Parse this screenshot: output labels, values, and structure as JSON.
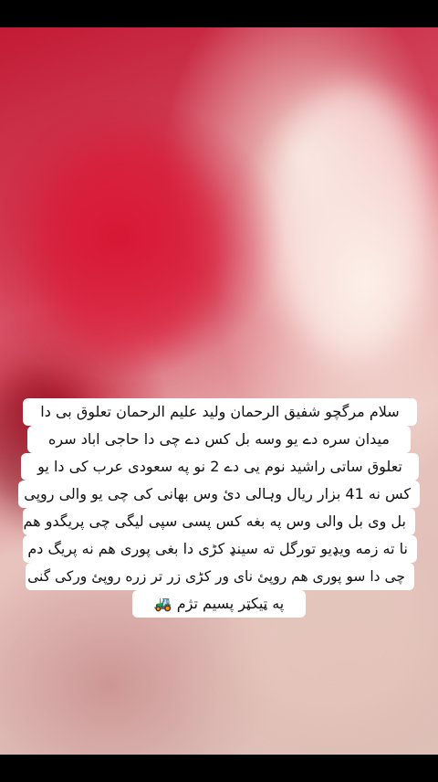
{
  "caption": {
    "lines": [
      "سلام مرگچو شفیق الرحمان ولید علیم الرحمان تعلوق بی دا",
      "میدان سره دے یو وسه بل کس دے چی دا حاجی اباد سره",
      "تعلوق ساتی راشید نوم یی دے 2 نو په سعودی عرب کی دا یو",
      "کس نه 41 بزار ریال وہالی دیٔ وس بهانی کی چی یو والی روپی",
      "بل وی بل والی وس په بغه کس پسی سپی لیگی چی پریگدو هم",
      "نا ته زمه ویډیو تورگل ته سینډ کڑی دا بغی پوری هم نه پریگ دم",
      "چی دا سو پوری هم روپئ نای ور کڑی زر تر زره روپئ ورکی گنی",
      "په ټیکټر پسیم تژم 🚜"
    ]
  },
  "colors": {
    "background": "#000000",
    "caption_bg": "#ffffff",
    "caption_text": "#111111",
    "video_accent": "#c21a35"
  }
}
